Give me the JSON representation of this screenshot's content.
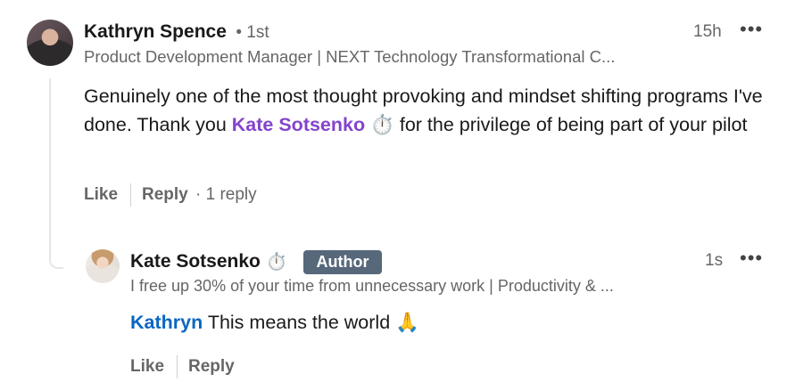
{
  "comment": {
    "author_name": "Kathryn Spence",
    "degree": "• 1st",
    "headline": "Product Development Manager | NEXT Technology Transformational C...",
    "timestamp": "15h",
    "more_icon": "•••",
    "text_before": "Genuinely one of the most thought provoking and mindset shifting programs I've done. Thank you ",
    "mention": "Kate Sotsenko",
    "mention_emoji": "⏱️",
    "text_after": " for the privilege of being part of your pilot",
    "like_label": "Like",
    "reply_label": "Reply",
    "reply_count": "· 1 reply"
  },
  "reply": {
    "author_name": "Kate Sotsenko",
    "name_emoji": "⏱️",
    "badge": "Author",
    "headline": "I free up 30% of your time from unnecessary work | Productivity & ...",
    "timestamp": "1s",
    "more_icon": "•••",
    "mention": "Kathryn",
    "text": " This means the world 🙏",
    "like_label": "Like",
    "reply_label": "Reply"
  },
  "colors": {
    "mention_purple": "#8344cc",
    "mention_blue": "#0a66c2",
    "badge_bg": "#56687a",
    "muted_text": "#666666"
  }
}
